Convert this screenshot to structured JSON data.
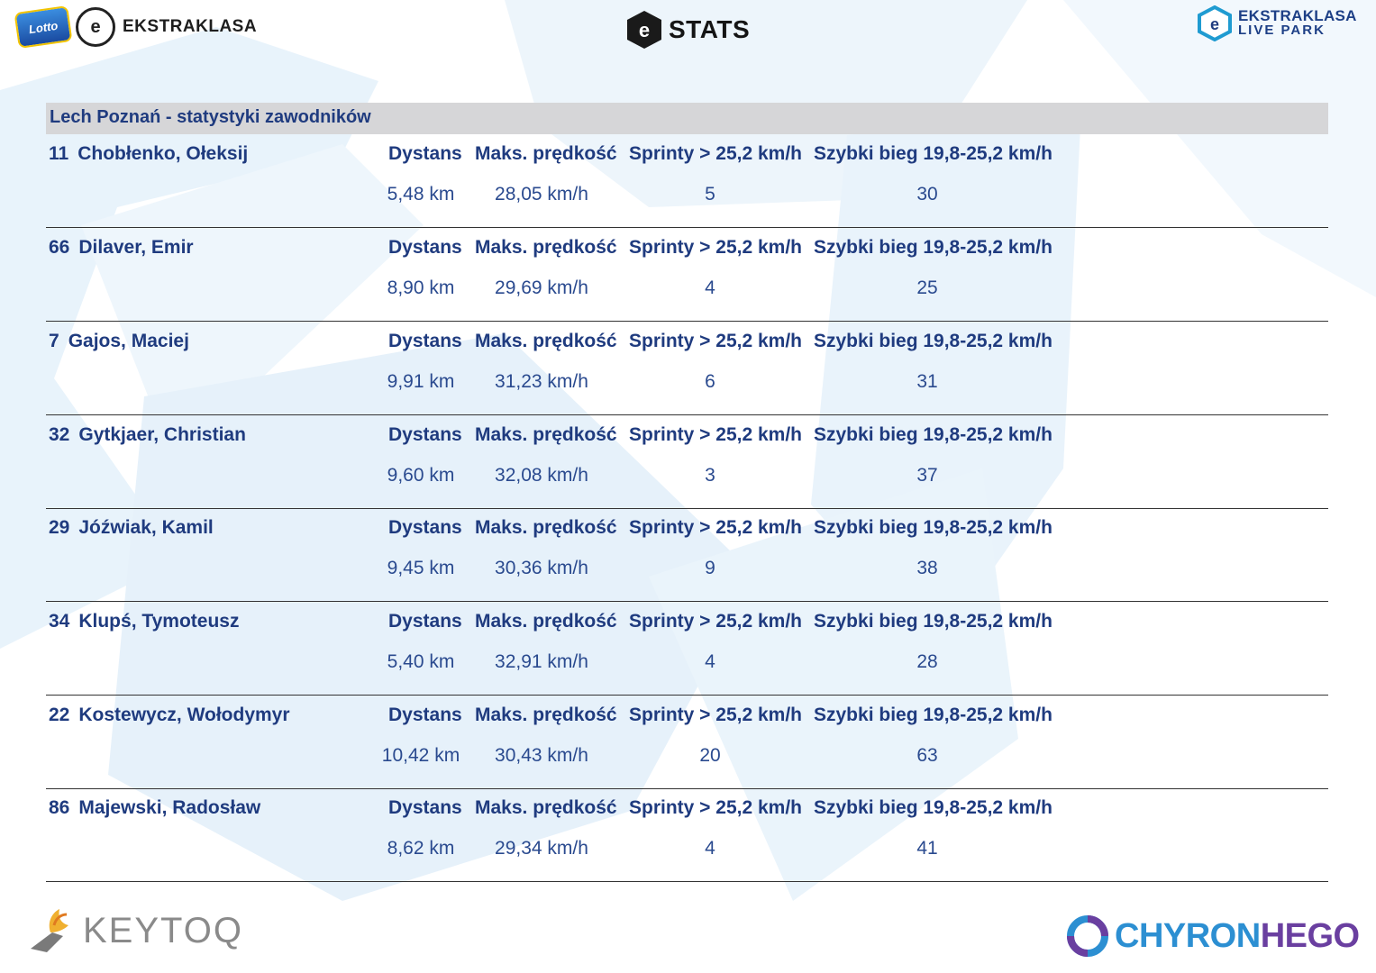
{
  "header": {
    "left_logo_text": "EKSTRAKLASA",
    "lotto_text": "Lotto",
    "center_logo_text": "STATS",
    "right_logo_line1": "EKSTRAKLASA",
    "right_logo_line2": "LIVE PARK"
  },
  "section": {
    "title": "Lech Poznań - statystyki zawodników"
  },
  "columns": {
    "distance": "Dystans",
    "max_speed": "Maks. prędkość",
    "sprints": "Sprinty > 25,2 km/h",
    "fast_run": "Szybki bieg 19,8-25,2 km/h"
  },
  "players": [
    {
      "number": "11",
      "name": "Chobłenko, Ołeksij",
      "distance": "5,48 km",
      "max_speed": "28,05 km/h",
      "sprints": "5",
      "fast_run": "30"
    },
    {
      "number": "66",
      "name": "Dilaver, Emir",
      "distance": "8,90 km",
      "max_speed": "29,69 km/h",
      "sprints": "4",
      "fast_run": "25"
    },
    {
      "number": "7",
      "name": "Gajos, Maciej",
      "distance": "9,91 km",
      "max_speed": "31,23 km/h",
      "sprints": "6",
      "fast_run": "31"
    },
    {
      "number": "32",
      "name": "Gytkjaer, Christian",
      "distance": "9,60 km",
      "max_speed": "32,08 km/h",
      "sprints": "3",
      "fast_run": "37"
    },
    {
      "number": "29",
      "name": "Jóźwiak, Kamil",
      "distance": "9,45 km",
      "max_speed": "30,36 km/h",
      "sprints": "9",
      "fast_run": "38"
    },
    {
      "number": "34",
      "name": "Klupś, Tymoteusz",
      "distance": "5,40 km",
      "max_speed": "32,91 km/h",
      "sprints": "4",
      "fast_run": "28"
    },
    {
      "number": "22",
      "name": "Kostewycz, Wołodymyr",
      "distance": "10,42 km",
      "max_speed": "30,43 km/h",
      "sprints": "20",
      "fast_run": "63"
    },
    {
      "number": "86",
      "name": "Majewski, Radosław",
      "distance": "8,62 km",
      "max_speed": "29,34 km/h",
      "sprints": "4",
      "fast_run": "41"
    }
  ],
  "footer": {
    "left_logo_text": "KEYTOQ",
    "right_logo_part1": "CHYRON",
    "right_logo_part2": "HEGO"
  },
  "colors": {
    "text_primary": "#1f3b7f",
    "section_bg": "#d6d6d8",
    "watermark": "#e3f0fa"
  }
}
